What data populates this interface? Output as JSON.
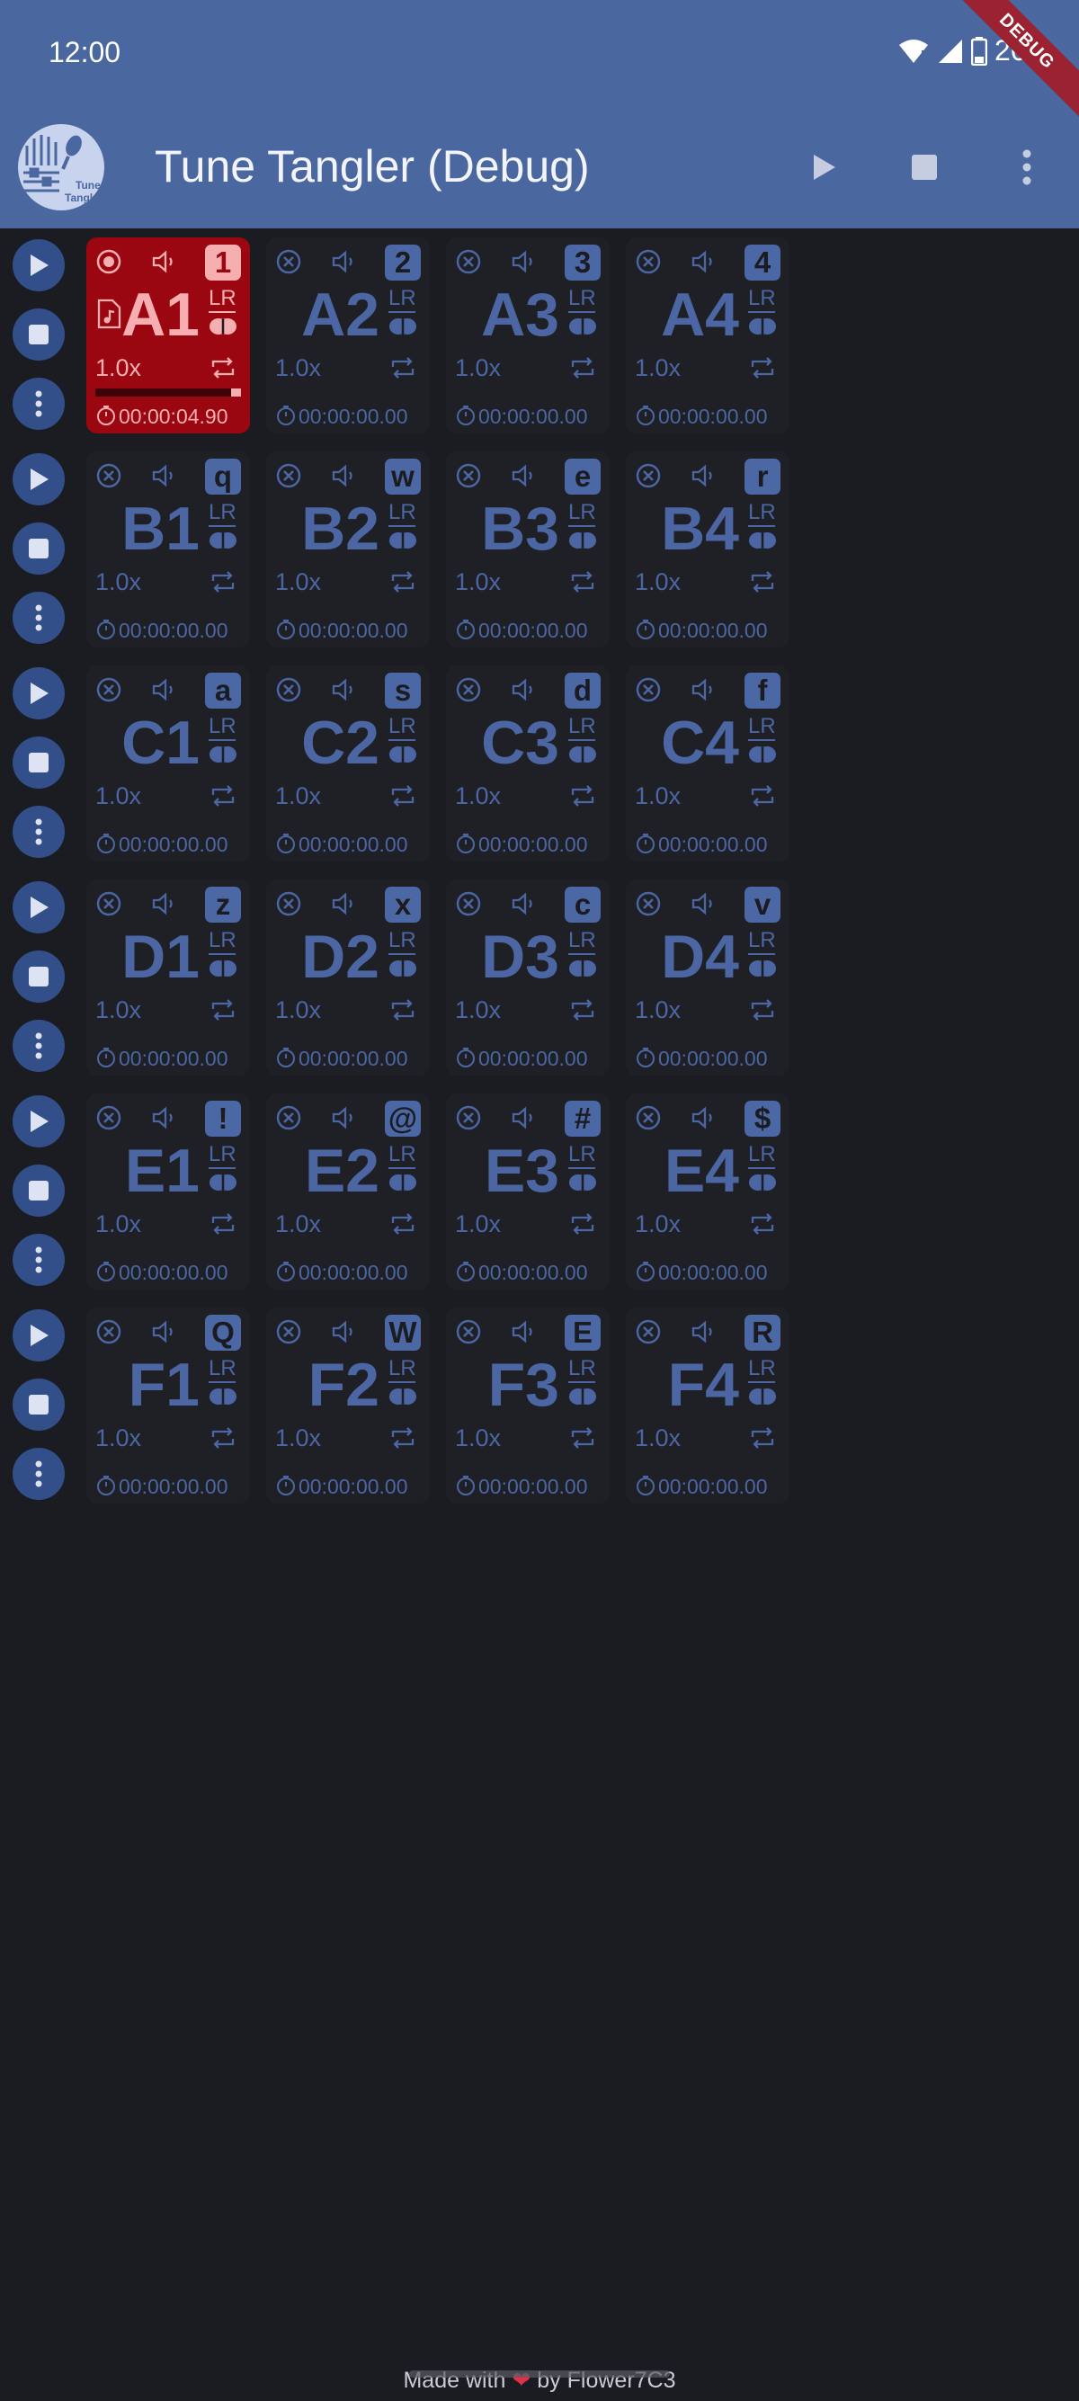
{
  "status_bar": {
    "time": "12:00",
    "battery": "26%"
  },
  "app_bar": {
    "title": "Tune Tangler (Debug)",
    "logo_text_top": "Tune",
    "logo_text_bottom": "Tangler",
    "debug_banner": "DEBUG"
  },
  "colors": {
    "app_bar": "#4a67a0",
    "background": "#1b1c21",
    "tile_idle": "#1f2026",
    "tile_active": "#9a0710",
    "accent": "#4b66a2",
    "active_text": "#f7aeb0"
  },
  "icons": {
    "row_controls": [
      "play-icon",
      "stop-icon",
      "more-vert-icon"
    ],
    "tile": [
      "close-circle-icon",
      "volume-icon",
      "file-music-icon",
      "pan-lr-icon",
      "loop-icon",
      "timer-icon"
    ]
  },
  "rows": [
    {
      "tiles": [
        {
          "name": "A1",
          "key": "1",
          "speed": "1.0x",
          "lr": "LR",
          "time": "00:00:04.90",
          "active": true,
          "progress": 0.07
        },
        {
          "name": "A2",
          "key": "2",
          "speed": "1.0x",
          "lr": "LR",
          "time": "00:00:00.00",
          "active": false
        },
        {
          "name": "A3",
          "key": "3",
          "speed": "1.0x",
          "lr": "LR",
          "time": "00:00:00.00",
          "active": false
        },
        {
          "name": "A4",
          "key": "4",
          "speed": "1.0x",
          "lr": "LR",
          "time": "00:00:00.00",
          "active": false
        }
      ]
    },
    {
      "tiles": [
        {
          "name": "B1",
          "key": "q",
          "speed": "1.0x",
          "lr": "LR",
          "time": "00:00:00.00",
          "active": false
        },
        {
          "name": "B2",
          "key": "w",
          "speed": "1.0x",
          "lr": "LR",
          "time": "00:00:00.00",
          "active": false
        },
        {
          "name": "B3",
          "key": "e",
          "speed": "1.0x",
          "lr": "LR",
          "time": "00:00:00.00",
          "active": false
        },
        {
          "name": "B4",
          "key": "r",
          "speed": "1.0x",
          "lr": "LR",
          "time": "00:00:00.00",
          "active": false
        }
      ]
    },
    {
      "tiles": [
        {
          "name": "C1",
          "key": "a",
          "speed": "1.0x",
          "lr": "LR",
          "time": "00:00:00.00",
          "active": false
        },
        {
          "name": "C2",
          "key": "s",
          "speed": "1.0x",
          "lr": "LR",
          "time": "00:00:00.00",
          "active": false
        },
        {
          "name": "C3",
          "key": "d",
          "speed": "1.0x",
          "lr": "LR",
          "time": "00:00:00.00",
          "active": false
        },
        {
          "name": "C4",
          "key": "f",
          "speed": "1.0x",
          "lr": "LR",
          "time": "00:00:00.00",
          "active": false
        }
      ]
    },
    {
      "tiles": [
        {
          "name": "D1",
          "key": "z",
          "speed": "1.0x",
          "lr": "LR",
          "time": "00:00:00.00",
          "active": false
        },
        {
          "name": "D2",
          "key": "x",
          "speed": "1.0x",
          "lr": "LR",
          "time": "00:00:00.00",
          "active": false
        },
        {
          "name": "D3",
          "key": "c",
          "speed": "1.0x",
          "lr": "LR",
          "time": "00:00:00.00",
          "active": false
        },
        {
          "name": "D4",
          "key": "v",
          "speed": "1.0x",
          "lr": "LR",
          "time": "00:00:00.00",
          "active": false
        }
      ]
    },
    {
      "tiles": [
        {
          "name": "E1",
          "key": "!",
          "speed": "1.0x",
          "lr": "LR",
          "time": "00:00:00.00",
          "active": false
        },
        {
          "name": "E2",
          "key": "@",
          "speed": "1.0x",
          "lr": "LR",
          "time": "00:00:00.00",
          "active": false
        },
        {
          "name": "E3",
          "key": "#",
          "speed": "1.0x",
          "lr": "LR",
          "time": "00:00:00.00",
          "active": false
        },
        {
          "name": "E4",
          "key": "$",
          "speed": "1.0x",
          "lr": "LR",
          "time": "00:00:00.00",
          "active": false
        }
      ]
    },
    {
      "tiles": [
        {
          "name": "F1",
          "key": "Q",
          "speed": "1.0x",
          "lr": "LR",
          "time": "00:00:00.00",
          "active": false
        },
        {
          "name": "F2",
          "key": "W",
          "speed": "1.0x",
          "lr": "LR",
          "time": "00:00:00.00",
          "active": false
        },
        {
          "name": "F3",
          "key": "E",
          "speed": "1.0x",
          "lr": "LR",
          "time": "00:00:00.00",
          "active": false
        },
        {
          "name": "F4",
          "key": "R",
          "speed": "1.0x",
          "lr": "LR",
          "time": "00:00:00.00",
          "active": false
        }
      ]
    }
  ],
  "footer": {
    "prefix": "Made with",
    "suffix": "by Flower7C3"
  }
}
